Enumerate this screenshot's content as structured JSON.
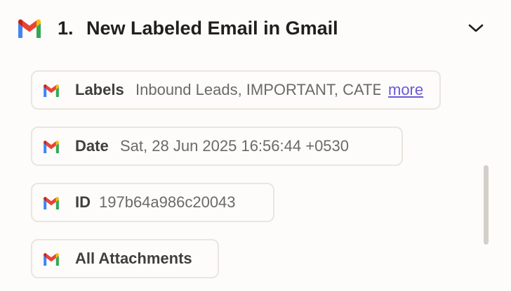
{
  "step": {
    "number": "1.",
    "title": "New Labeled Email in Gmail"
  },
  "fields": [
    {
      "key": "Labels",
      "value": "Inbound Leads, IMPORTANT, CATEGORY_PERSONAL",
      "more": "more",
      "icon": "gmail-icon"
    },
    {
      "key": "Date",
      "value": "Sat, 28 Jun 2025 16:56:44 +0530",
      "icon": "gmail-icon"
    },
    {
      "key": "ID",
      "value": "197b64a986c20043",
      "icon": "gmail-icon"
    },
    {
      "key": "All Attachments",
      "value": "",
      "icon": "gmail-icon"
    }
  ],
  "colors": {
    "gmail_red": "#ea4335",
    "gmail_blue": "#4285f4",
    "gmail_green": "#34a853",
    "gmail_yellow": "#fbbc04",
    "link": "#6a5ad7"
  }
}
